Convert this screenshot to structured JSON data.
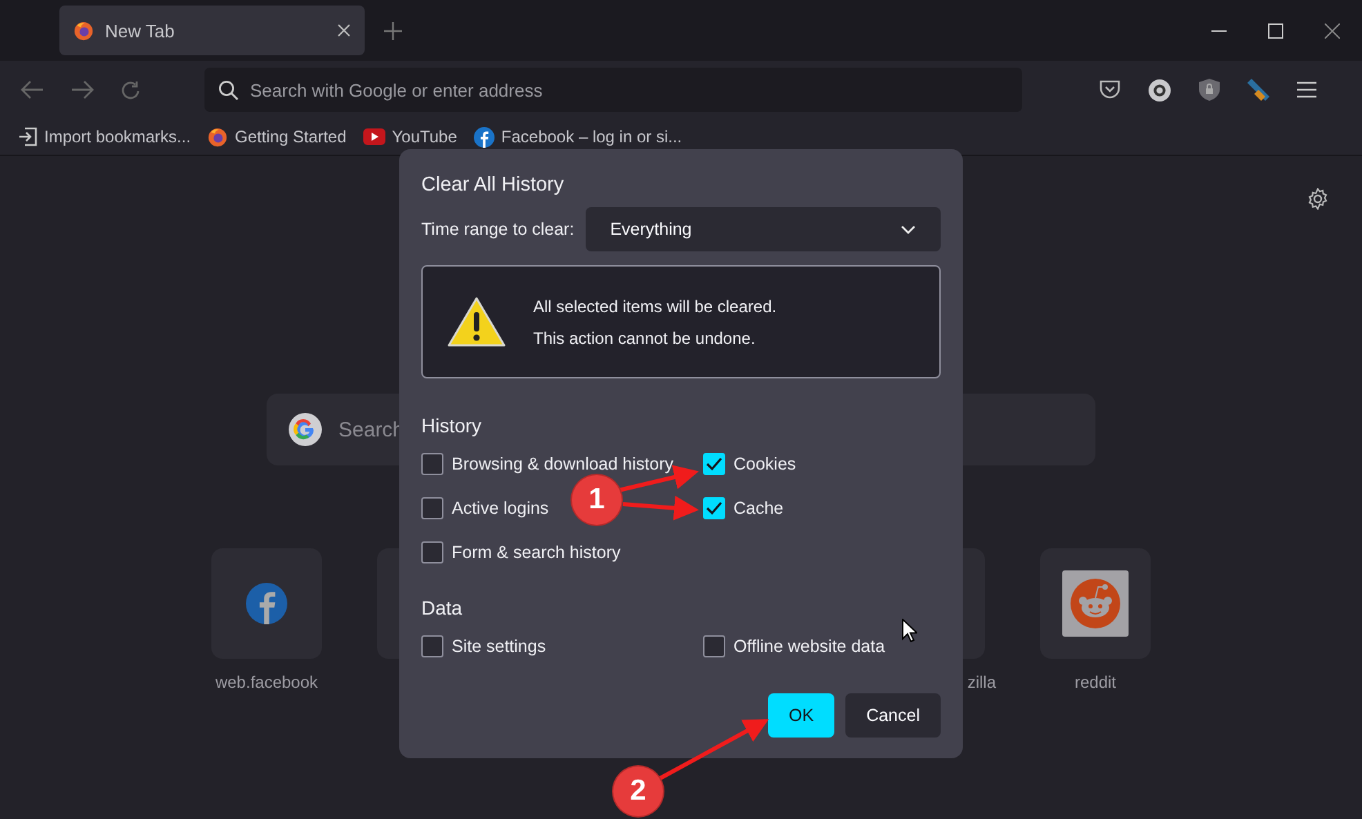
{
  "tabs": [
    {
      "title": "New Tab",
      "selected": true
    }
  ],
  "toolbar": {
    "address_placeholder": "Search with Google or enter address"
  },
  "bookmarks": [
    {
      "label": "Import bookmarks...",
      "kind": "import"
    },
    {
      "label": "Getting Started",
      "kind": "firefox"
    },
    {
      "label": "YouTube",
      "kind": "youtube"
    },
    {
      "label": "Facebook – log in or si...",
      "kind": "facebook"
    }
  ],
  "new_tab": {
    "search_placeholder": "Search",
    "top_sites": [
      {
        "label": "web.facebook",
        "kind": "facebook"
      },
      {
        "kind": "blank"
      },
      {
        "label": "zilla",
        "kind": "cut"
      },
      {
        "label": "reddit",
        "kind": "reddit"
      }
    ]
  },
  "dialog": {
    "title": "Clear All History",
    "time_range_label": "Time range to clear:",
    "time_range_value": "Everything",
    "warning": [
      "All selected items will be cleared.",
      "This action cannot be undone."
    ],
    "sections": [
      {
        "heading": "History",
        "options": [
          {
            "label": "Browsing & download history",
            "checked": false
          },
          {
            "label": "Cookies",
            "checked": true
          },
          {
            "label": "Active logins",
            "checked": false
          },
          {
            "label": "Cache",
            "checked": true
          },
          {
            "label": "Form & search history",
            "checked": false
          }
        ]
      },
      {
        "heading": "Data",
        "options": [
          {
            "label": "Site settings",
            "checked": false
          },
          {
            "label": "Offline website data",
            "checked": false
          }
        ]
      }
    ],
    "buttons": [
      {
        "label": "OK",
        "kind": "primary"
      },
      {
        "label": "Cancel",
        "kind": "secondary"
      }
    ]
  },
  "annotations": [
    {
      "number": "1"
    },
    {
      "number": "2"
    }
  ]
}
